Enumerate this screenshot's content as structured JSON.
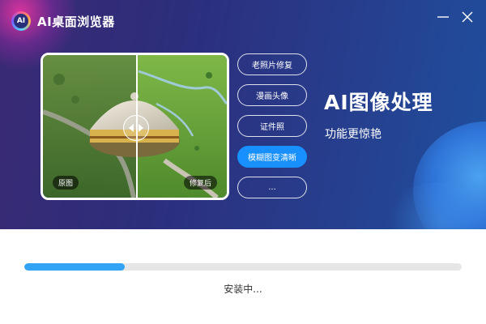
{
  "app": {
    "title": "AI桌面浏览器",
    "logo_text": "AI",
    "logo_icon": "ai-logo-icon"
  },
  "window_controls": [
    {
      "name": "minimize-icon"
    },
    {
      "name": "close-icon"
    }
  ],
  "preview": {
    "before_label": "原图",
    "after_label": "修复后",
    "handle_icon": "compare-arrows-icon"
  },
  "options": [
    {
      "label": "老照片修复",
      "active": false
    },
    {
      "label": "漫画头像",
      "active": false
    },
    {
      "label": "证件照",
      "active": false
    },
    {
      "label": "模糊图变清晰",
      "active": true
    },
    {
      "label": "...",
      "active": false
    }
  ],
  "feature": {
    "title": "AI图像处理",
    "subtitle": "功能更惊艳"
  },
  "install": {
    "progress": 0.23,
    "status": "安装中..."
  },
  "colors": {
    "accent": "#1890ff",
    "progress": "#33a3f5",
    "banner_start": "#3a2a73",
    "banner_end": "#1f4f9e"
  }
}
